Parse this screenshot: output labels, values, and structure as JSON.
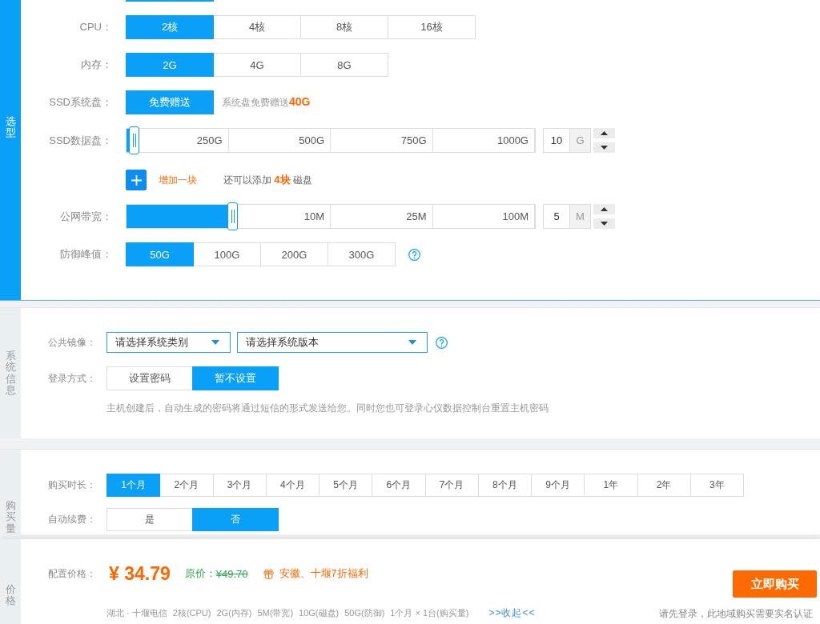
{
  "spec": {
    "title": "选型",
    "rows": [
      {
        "kind": "cut_off",
        "options": [
          {
            "selected": true
          }
        ]
      },
      {
        "kind": "options",
        "label": "CPU：",
        "options": [
          {
            "label": "2核",
            "selected": true
          },
          {
            "label": "4核",
            "selected": false
          },
          {
            "label": "8核",
            "selected": false
          },
          {
            "label": "16核",
            "selected": false
          }
        ]
      },
      {
        "kind": "options",
        "label": "内存：",
        "options": [
          {
            "label": "2G",
            "selected": true
          },
          {
            "label": "4G",
            "selected": false
          },
          {
            "label": "8G",
            "selected": false
          }
        ]
      },
      {
        "kind": "options",
        "label": "SSD系统盘：",
        "options": [
          {
            "label": "免费赠送",
            "selected": true
          }
        ],
        "note": "系统盘免费赠送**40G**"
      },
      {
        "kind": "slider",
        "label": "SSD数据盘：",
        "marks": [
          "250G",
          "500G",
          "750G",
          "1000G"
        ],
        "level": 0.02,
        "value": "10",
        "unit": "G"
      },
      {
        "kind": "add",
        "action": "增加一块",
        "note": "还可以添加 **4块** 磁盘"
      },
      {
        "kind": "slider",
        "label": "公网带宽：",
        "marks": [
          "10M",
          "25M",
          "100M"
        ],
        "level": 0.26,
        "value": "5",
        "unit": "M"
      },
      {
        "kind": "options",
        "label": "防御峰值：",
        "options": [
          {
            "label": "50G",
            "selected": true
          },
          {
            "label": "100G",
            "selected": false
          },
          {
            "label": "200G",
            "selected": false
          },
          {
            "label": "300G",
            "selected": false
          }
        ],
        "help": true
      }
    ]
  },
  "system": {
    "title": "系统信息",
    "rows": [
      {
        "kind": "selects",
        "label": "公共镜像：",
        "selects": [
          {
            "placeholder": "请选择系统类别"
          },
          {
            "placeholder": "请选择系统版本"
          }
        ],
        "help": true
      },
      {
        "kind": "options",
        "label": "登录方式：",
        "options": [
          {
            "label": "设置密码",
            "selected": false
          },
          {
            "label": "暂不设置",
            "selected": true
          }
        ]
      },
      {
        "kind": "hint",
        "text": "主机创建后，自动生成的密码将通过短信的形式发送给您。同时您也可登录心仪数据控制台重置主机密码"
      }
    ]
  },
  "purchase": {
    "title": "购买量",
    "rows": [
      {
        "kind": "options",
        "label": "购买时长：",
        "options": [
          {
            "label": "1个月",
            "selected": true
          },
          {
            "label": "2个月",
            "selected": false
          },
          {
            "label": "3个月",
            "selected": false
          },
          {
            "label": "4个月",
            "selected": false
          },
          {
            "label": "5个月",
            "selected": false
          },
          {
            "label": "6个月",
            "selected": false
          },
          {
            "label": "7个月",
            "selected": false
          },
          {
            "label": "8个月",
            "selected": false
          },
          {
            "label": "9个月",
            "selected": false
          },
          {
            "label": "1年",
            "selected": false
          },
          {
            "label": "2年",
            "selected": false
          },
          {
            "label": "3年",
            "selected": false
          }
        ]
      },
      {
        "kind": "options",
        "label": "自动续费：",
        "options": [
          {
            "label": "是",
            "selected": false
          },
          {
            "label": "否",
            "selected": true
          }
        ]
      }
    ]
  },
  "price": {
    "title": "价格",
    "label": "配置价格：",
    "amount": "¥ 34.79",
    "original_label": "原价：",
    "original_amount": "¥49.70",
    "promo": "安徽、十堰7折福利",
    "summary": [
      "湖北 · 十堰电信",
      "2核(CPU)",
      "2G(内存)",
      "5M(带宽)",
      "10G(磁盘)",
      "50G(防御)",
      "1个月 × 1台(购买量)"
    ],
    "toggle": ">>收起<<",
    "buy_button": "立即购买",
    "notice": "请先登录，此地域购买需要实名认证"
  }
}
